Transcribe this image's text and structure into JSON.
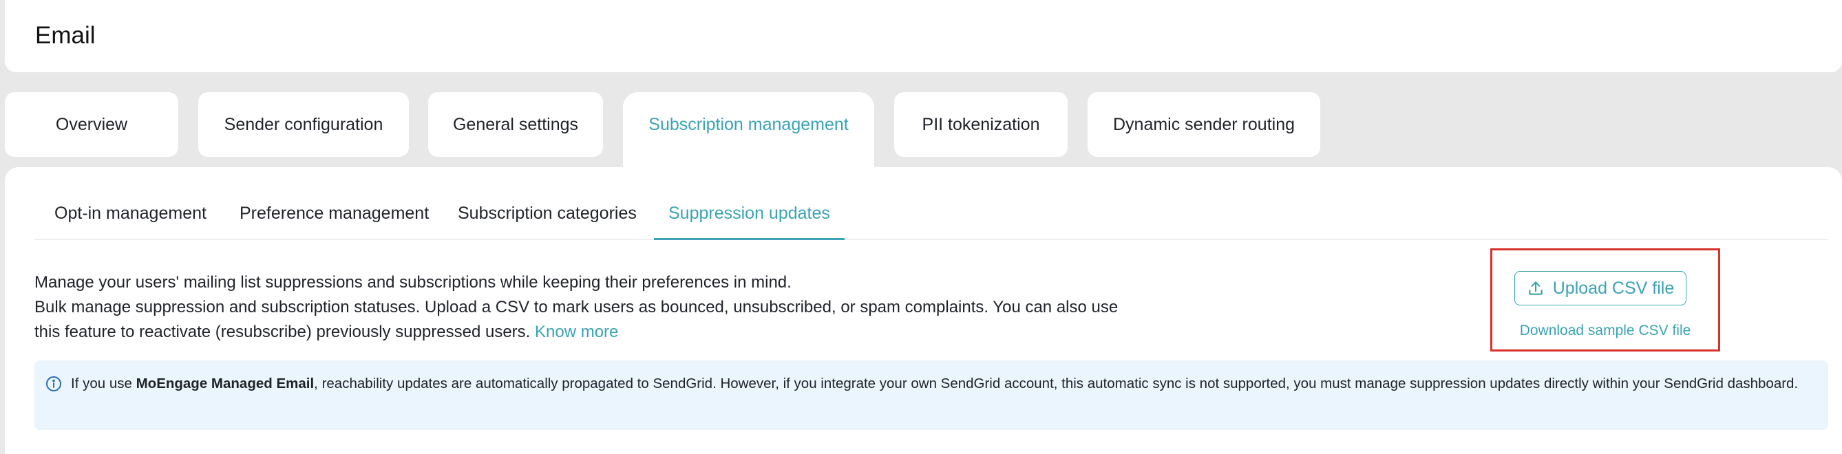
{
  "page": {
    "title": "Email"
  },
  "tabs": [
    {
      "label": "Overview"
    },
    {
      "label": "Sender configuration"
    },
    {
      "label": "General settings"
    },
    {
      "label": "Subscription management",
      "active": true
    },
    {
      "label": "PII tokenization"
    },
    {
      "label": "Dynamic sender routing"
    }
  ],
  "subtabs": [
    {
      "label": "Opt-in management"
    },
    {
      "label": "Preference management"
    },
    {
      "label": "Subscription categories"
    },
    {
      "label": "Suppression updates",
      "active": true
    }
  ],
  "description": {
    "line1": "Manage your users' mailing list suppressions and subscriptions while keeping their preferences in mind.",
    "line2": "Bulk manage suppression and subscription statuses. Upload a CSV to mark users as bounced, unsubscribed, or spam complaints. You can also use this feature to reactivate (resubscribe) previously suppressed users.",
    "link": "Know more"
  },
  "upload": {
    "button_label": "Upload CSV file",
    "icon": "upload-icon",
    "download_link": "Download sample CSV file"
  },
  "info": {
    "icon": "info-icon",
    "prefix": "If you use ",
    "bold": "MoEngage Managed Email",
    "suffix": ", reachability updates are automatically propagated to SendGrid. However, if you integrate your own SendGrid account, this automatic sync is not supported, you must manage suppression updates directly within your SendGrid dashboard."
  },
  "colors": {
    "accent": "#3aa3b5",
    "highlight_border": "#d9302c",
    "info_bg": "#ebf5fd",
    "page_bg": "#e8e8e8"
  }
}
